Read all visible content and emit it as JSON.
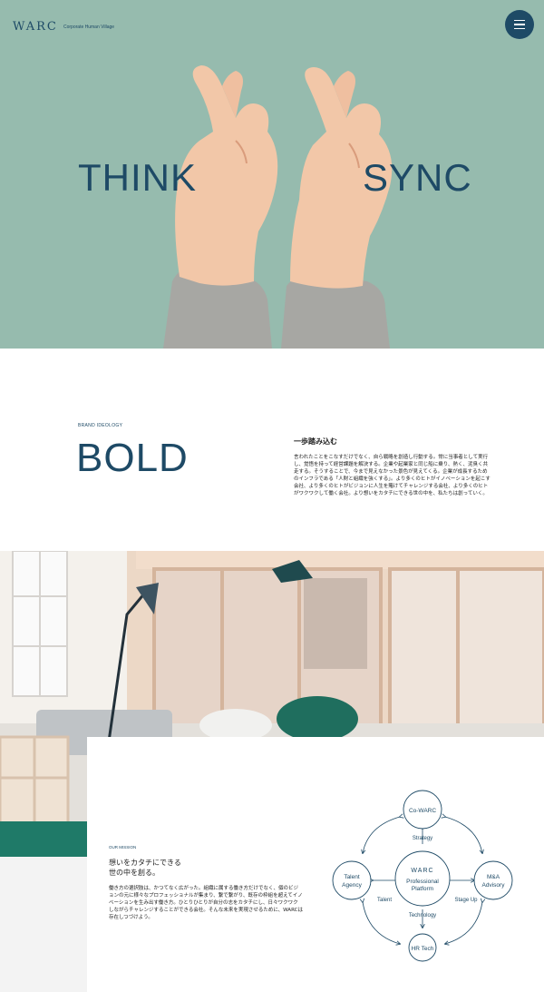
{
  "header": {
    "logo": "WARC",
    "tagline": "Corporate Human Village",
    "menu_icon": "hamburger-menu-icon"
  },
  "hero": {
    "word_left": "THINK",
    "word_right": "SYNC"
  },
  "brand": {
    "label": "BRAND IDEOLOGY",
    "word": "BOLD",
    "heading": "一歩踏み込む",
    "body": "言われたことをこなすだけでなく、自ら戦略を創造し行動する。常に当事者として実行し、覚悟を持って経営課題を解決する。企業や起業家と同じ船に乗り、熱く、泥臭く共走する。そうすることで、今まで見えなかった景色が見えてくる。企業が成長するためのインフラである「人財と組織を強くする」。より多くのヒトがイノベーションを起こす会社、より多くのヒトがビジョンに人生を賭けてチャレンジする会社、より多くのヒトがワクワクして働く会社。より想いをカタチにできる世の中を、私たちは創っていく。"
  },
  "mission": {
    "label": "OUR MISSION",
    "heading_line1": "想いをカタチにできる",
    "heading_line2": "世の中を創る。",
    "body": "働き方の選択肢は、かつてなく広がった。組織に属する働き方だけでなく、個のビジョンの元に様々なプロフェッショナルが集まり、繋で繋がり、既存の枠組を超えてイノベーションを生み出す働き方。ひとりひとりが自分の志をカタチにし、日々ワクワクしながらチャレンジすることができる会社。そんな未来を実現させるために、WARCは存在しつづけよう。"
  },
  "diagram": {
    "center_logo": "WARC",
    "center_line1": "Professional",
    "center_line2": "Platform",
    "top": "Co-WARC",
    "left_line1": "Talent",
    "left_line2": "Agency",
    "right_line1": "M&A",
    "right_line2": "Advisory",
    "bottom": "HR Tech",
    "arrow_top": "Strategy",
    "arrow_left": "Talent",
    "arrow_right": "Stage Up",
    "arrow_bottom": "Technology"
  }
}
